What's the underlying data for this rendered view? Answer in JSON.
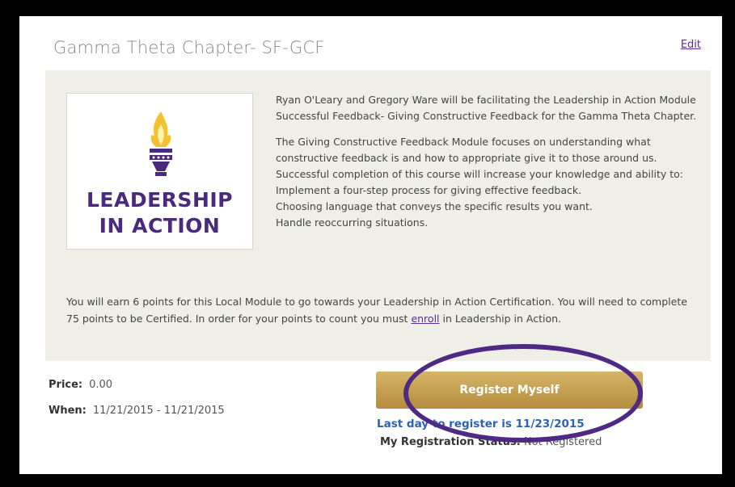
{
  "header": {
    "title": "Gamma Theta Chapter- SF-GCF",
    "edit_label": "Edit"
  },
  "logo": {
    "line1": "LEADERSHIP",
    "line2": "IN ACTION",
    "icon": "torch-icon",
    "brand_purple": "#4b2a7d",
    "brand_gold": "#f2c22e"
  },
  "description": {
    "intro": "Ryan O'Leary and Gregory Ware will be facilitating the Leadership in Action Module Successful Feedback- Giving Constructive Feedback for the Gamma Theta Chapter.",
    "body": "The Giving Constructive Feedback Module focuses on understanding what constructive feedback is and how to appropriate give it to those around us. Successful completion of this course will increase your knowledge and ability to:",
    "bullets": [
      "Implement a four-step process for giving effective feedback.",
      "Choosing language that conveys the specific results you want.",
      "Handle reoccurring situations."
    ]
  },
  "points": {
    "text_before": "You will earn 6 points for this Local Module to go towards your Leadership in Action Certification. You will need to complete 75 points to be Certified. In order for your points to count you must ",
    "enroll_link": "enroll",
    "text_after": " in Leadership in Action."
  },
  "details": {
    "price_label": "Price:",
    "price_value": "0.00",
    "when_label": "When:",
    "when_value": "11/21/2015 - 11/21/2015"
  },
  "registration": {
    "button_label": "Register Myself",
    "last_day": "Last day to register is 11/23/2015",
    "status_label": "My Registration Status:",
    "status_value": "Not Registered"
  },
  "colors": {
    "button_gold": "#c9a455",
    "link_blue": "#2a62b8",
    "annotation_purple": "#4f2a85"
  }
}
